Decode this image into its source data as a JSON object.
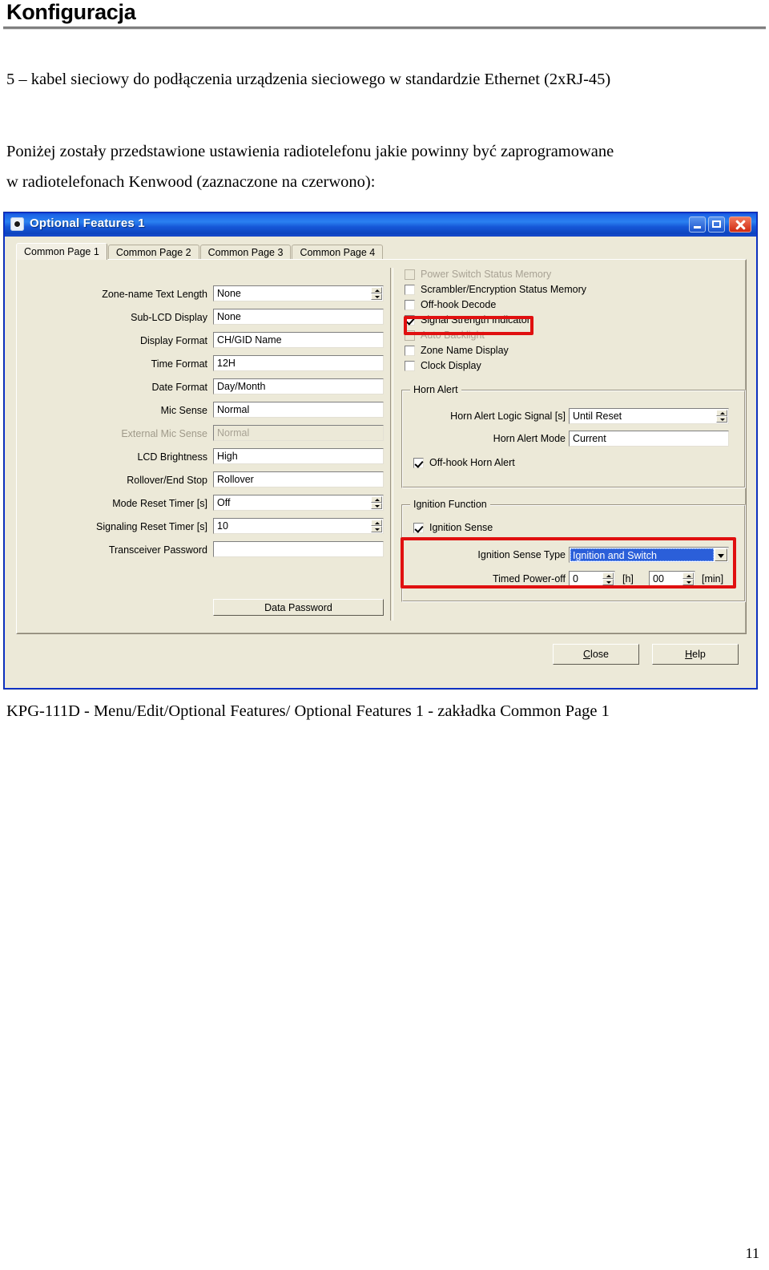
{
  "document": {
    "title": "Konfiguracja",
    "paragraph_1": "5 –  kabel sieciowy do podłączenia urządzenia sieciowego w standardzie Ethernet (2xRJ-45)",
    "paragraph_2_line1": "Poniżej zostały przedstawione ustawienia radiotelefonu jakie powinny być zaprogramowane",
    "paragraph_2_line2": "w radiotelefonach Kenwood (zaznaczone na czerwono):",
    "caption": "KPG-111D - Menu/Edit/Optional Features/ Optional Features 1 - zakładka Common Page 1",
    "page_number": "11"
  },
  "dialog": {
    "title": "Optional Features 1",
    "icon": "app-icon",
    "window_buttons": {
      "minimize": "minimize-icon",
      "maximize": "maximize-icon",
      "close": "close-icon"
    },
    "tabs": [
      {
        "label": "Common Page 1",
        "active": true
      },
      {
        "label": "Common Page 2",
        "active": false
      },
      {
        "label": "Common Page 3",
        "active": false
      },
      {
        "label": "Common Page 4",
        "active": false
      }
    ],
    "left_fields": [
      {
        "label": "Zone-name Text Length",
        "value": "None",
        "spinner": true,
        "disabled": false
      },
      {
        "label": "Sub-LCD Display",
        "value": "None",
        "spinner": false,
        "disabled": false
      },
      {
        "label": "Display Format",
        "value": "CH/GID Name",
        "spinner": false,
        "disabled": false
      },
      {
        "label": "Time Format",
        "value": "12H",
        "spinner": false,
        "disabled": false
      },
      {
        "label": "Date Format",
        "value": "Day/Month",
        "spinner": false,
        "disabled": false
      },
      {
        "label": "Mic Sense",
        "value": "Normal",
        "spinner": false,
        "disabled": false
      },
      {
        "label": "External Mic Sense",
        "value": "Normal",
        "spinner": false,
        "disabled": true
      },
      {
        "label": "LCD Brightness",
        "value": "High",
        "spinner": false,
        "disabled": false
      },
      {
        "label": "Rollover/End Stop",
        "value": "Rollover",
        "spinner": false,
        "disabled": false
      },
      {
        "label": "Mode Reset Timer [s]",
        "value": "Off",
        "spinner": true,
        "disabled": false
      },
      {
        "label": "Signaling Reset Timer [s]",
        "value": "10",
        "spinner": true,
        "disabled": false
      },
      {
        "label": "Transceiver Password",
        "value": "",
        "spinner": false,
        "disabled": false
      }
    ],
    "data_password_button": "Data Password",
    "checkboxes": [
      {
        "label": "Power Switch Status Memory",
        "checked": false,
        "disabled": true,
        "highlighted": false
      },
      {
        "label": "Scrambler/Encryption Status Memory",
        "checked": false,
        "disabled": false,
        "highlighted": false
      },
      {
        "label": "Off-hook Decode",
        "checked": false,
        "disabled": false,
        "highlighted": true
      },
      {
        "label": "Signal Strength Indicator",
        "checked": true,
        "disabled": false,
        "highlighted": false
      },
      {
        "label": "Auto Backlight",
        "checked": false,
        "disabled": true,
        "highlighted": false
      },
      {
        "label": "Zone Name Display",
        "checked": false,
        "disabled": false,
        "highlighted": false
      },
      {
        "label": "Clock Display",
        "checked": false,
        "disabled": false,
        "highlighted": false
      }
    ],
    "horn_alert": {
      "group_label": "Horn Alert",
      "logic_signal_label": "Horn Alert Logic Signal [s]",
      "logic_signal_value": "Until Reset",
      "mode_label": "Horn Alert Mode",
      "mode_value": "Current",
      "offhook_checkbox_label": "Off-hook Horn Alert",
      "offhook_checked": true
    },
    "ignition_function": {
      "group_label": "Ignition Function",
      "ignition_sense_label": "Ignition Sense",
      "ignition_sense_checked": true,
      "ignition_sense_type_label": "Ignition Sense Type",
      "ignition_sense_type_value": "Ignition and Switch",
      "timed_power_off_label": "Timed Power-off",
      "hours_value": "0",
      "hours_unit": "[h]",
      "minutes_value": "00",
      "minutes_unit": "[min]"
    },
    "buttons": {
      "close": "Close",
      "help": "Help"
    }
  },
  "colors": {
    "titlebar_blue": "#1d66e8",
    "dialog_face": "#ece9d8",
    "annotation_red": "#e01010",
    "selection_blue": "#2b5fd9"
  }
}
